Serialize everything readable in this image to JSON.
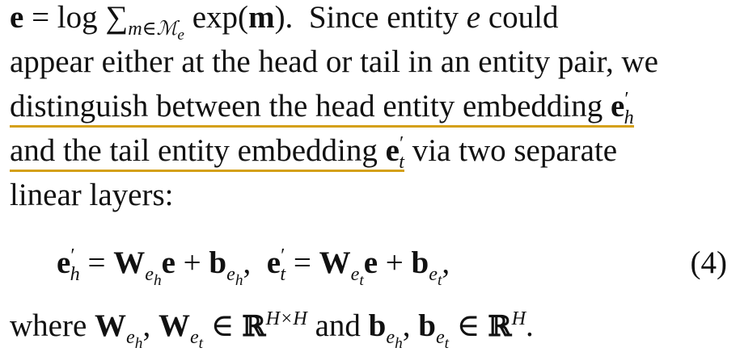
{
  "paragraph": {
    "line1_math": "e = log ∑",
    "line1_sub": "m∈ℳ",
    "line1_subsub": "e",
    "line1_exp": "exp(",
    "line1_m": "m",
    "line1_close": ").",
    "line1_text": "Since entity",
    "line1_e": "e",
    "line1_tail": "could",
    "line2": "appear either at the head or tail in an entity pair, we",
    "line3": "distinguish between the head entity embedding",
    "line4_a": "and the tail entity embedding",
    "line4_b": "via two separate",
    "line5": "linear layers:"
  },
  "equation": {
    "number": "(4)"
  },
  "last_line": {
    "where": "where",
    "and": "and",
    "in": "∈",
    "R": "ℝ",
    "HxH": "H×H",
    "H": "H",
    "period": "."
  },
  "highlight_color": "#d4a017"
}
